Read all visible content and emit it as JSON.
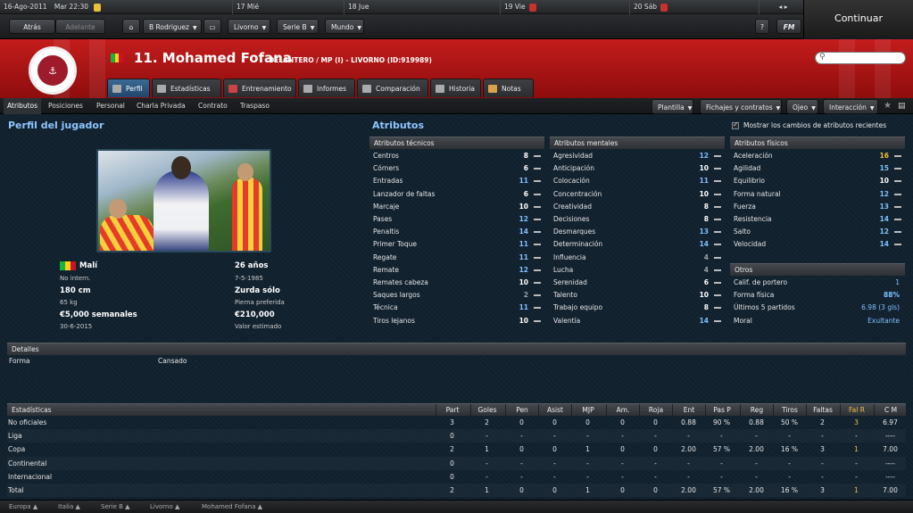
{
  "calendar": {
    "date": "16-Ago-2011",
    "time": "Mar 22:30",
    "days": [
      "17 Mié",
      "18 Jue",
      "19 Vie",
      "20 Sáb"
    ]
  },
  "continue_label": "Continuar",
  "nav": {
    "back": "Atrás",
    "forward": "Adelante",
    "manager": "B Rodriguez",
    "club": "Livorno",
    "league": "Serie B",
    "world": "Mundo",
    "help": "?",
    "fm": "FM"
  },
  "player": {
    "name": "11. Mohamed Fofana",
    "role": "DELANTERO / MP (I) - LIVORNO (ID:919989)",
    "nationality": "Malí",
    "intl": "No intern.",
    "height": "180 cm",
    "weight": "65 kg",
    "wage": "€5,000 semanales",
    "contract_end": "30-6-2015",
    "age": "26 años",
    "dob": "7-5-1985",
    "foot": "Zurda sólo",
    "foot_label": "Pierna preferida",
    "value": "€210,000",
    "value_label": "Valor estimado"
  },
  "tabs": [
    "Perfil",
    "Estadísticas",
    "Entrenamiento",
    "Informes",
    "Comparación",
    "Historia",
    "Notas"
  ],
  "subnav": [
    "Atributos",
    "Posiciones",
    "Personal",
    "Charla Privada",
    "Contrato",
    "Traspaso"
  ],
  "actions": [
    "Plantilla",
    "Fichajes y contratos",
    "Ojeo",
    "Interacción"
  ],
  "profile_title": "Perfil del jugador",
  "attributes_title": "Atributos",
  "show_changes_label": "Mostrar los cambios de atributos recientes",
  "technical": {
    "title": "Atributos técnicos",
    "items": [
      {
        "name": "Centros",
        "value": "8"
      },
      {
        "name": "Córners",
        "value": "6"
      },
      {
        "name": "Entradas",
        "value": "11"
      },
      {
        "name": "Lanzador de faltas",
        "value": "6"
      },
      {
        "name": "Marcaje",
        "value": "10"
      },
      {
        "name": "Pases",
        "value": "12"
      },
      {
        "name": "Penaltis",
        "value": "14"
      },
      {
        "name": "Primer Toque",
        "value": "11"
      },
      {
        "name": "Regate",
        "value": "11"
      },
      {
        "name": "Remate",
        "value": "12"
      },
      {
        "name": "Remates cabeza",
        "value": "10"
      },
      {
        "name": "Saques largos",
        "value": "2"
      },
      {
        "name": "Técnica",
        "value": "11"
      },
      {
        "name": "Tiros lejanos",
        "value": "10"
      }
    ]
  },
  "mental": {
    "title": "Atributos mentales",
    "items": [
      {
        "name": "Agresividad",
        "value": "12"
      },
      {
        "name": "Anticipación",
        "value": "10"
      },
      {
        "name": "Colocación",
        "value": "11"
      },
      {
        "name": "Concentración",
        "value": "10"
      },
      {
        "name": "Creatividad",
        "value": "8"
      },
      {
        "name": "Decisiones",
        "value": "8"
      },
      {
        "name": "Desmarques",
        "value": "13"
      },
      {
        "name": "Determinación",
        "value": "14"
      },
      {
        "name": "Influencia",
        "value": "4"
      },
      {
        "name": "Lucha",
        "value": "4"
      },
      {
        "name": "Serenidad",
        "value": "6"
      },
      {
        "name": "Talento",
        "value": "10"
      },
      {
        "name": "Trabajo equipo",
        "value": "8"
      },
      {
        "name": "Valentía",
        "value": "14"
      }
    ]
  },
  "physical": {
    "title": "Atributos físicos",
    "items": [
      {
        "name": "Aceleración",
        "value": "16"
      },
      {
        "name": "Agilidad",
        "value": "15"
      },
      {
        "name": "Equilibrio",
        "value": "10"
      },
      {
        "name": "Forma natural",
        "value": "12"
      },
      {
        "name": "Fuerza",
        "value": "13"
      },
      {
        "name": "Resistencia",
        "value": "14"
      },
      {
        "name": "Salto",
        "value": "12"
      },
      {
        "name": "Velocidad",
        "value": "14"
      }
    ]
  },
  "others": {
    "title": "Otros",
    "items": [
      {
        "name": "Calif. de portero",
        "value": "1"
      },
      {
        "name": "Forma física",
        "value": "88%"
      },
      {
        "name": "Últimos 5 partidos",
        "value": "6.98 (3 gls)"
      },
      {
        "name": "Moral",
        "value": "Exultante"
      }
    ]
  },
  "details": {
    "title": "Detalles",
    "label": "Forma",
    "value": "Cansado"
  },
  "stats": {
    "title": "Estadísticas",
    "columns": [
      "Part",
      "Goles",
      "Pen",
      "Asist",
      "MJP",
      "Am.",
      "Roja",
      "Ent",
      "Pas P",
      "Reg",
      "Tiros",
      "Faltas",
      "Fal R",
      "C M"
    ],
    "rows": [
      {
        "label": "No oficiales",
        "values": [
          "3",
          "2",
          "0",
          "0",
          "0",
          "0",
          "0",
          "0.88",
          "90 %",
          "0.88",
          "50 %",
          "2",
          "3",
          "6.97"
        ]
      },
      {
        "label": "Liga",
        "values": [
          "0",
          "-",
          "-",
          "-",
          "-",
          "-",
          "-",
          "-",
          "-",
          "-",
          "-",
          "-",
          "-",
          "----"
        ]
      },
      {
        "label": "Copa",
        "values": [
          "2",
          "1",
          "0",
          "0",
          "1",
          "0",
          "0",
          "2.00",
          "57 %",
          "2.00",
          "16 %",
          "3",
          "1",
          "7.00"
        ]
      },
      {
        "label": "Continental",
        "values": [
          "0",
          "-",
          "-",
          "-",
          "-",
          "-",
          "-",
          "-",
          "-",
          "-",
          "-",
          "-",
          "-",
          "----"
        ]
      },
      {
        "label": "Internacional",
        "values": [
          "0",
          "-",
          "-",
          "-",
          "-",
          "-",
          "-",
          "-",
          "-",
          "-",
          "-",
          "-",
          "-",
          "----"
        ]
      },
      {
        "label": "Total",
        "values": [
          "2",
          "1",
          "0",
          "0",
          "1",
          "0",
          "0",
          "2.00",
          "57 %",
          "2.00",
          "16 %",
          "3",
          "1",
          "7.00"
        ]
      }
    ]
  },
  "footer": [
    "Europa",
    "Italia",
    "Serie B",
    "Livorno",
    "Mohamed Fofana"
  ],
  "colors": {
    "header_red": "#b51717",
    "attr_blue": "#7ec1ff",
    "attr_highlight": "#f0c040",
    "section_title": "#8ec6ff"
  }
}
